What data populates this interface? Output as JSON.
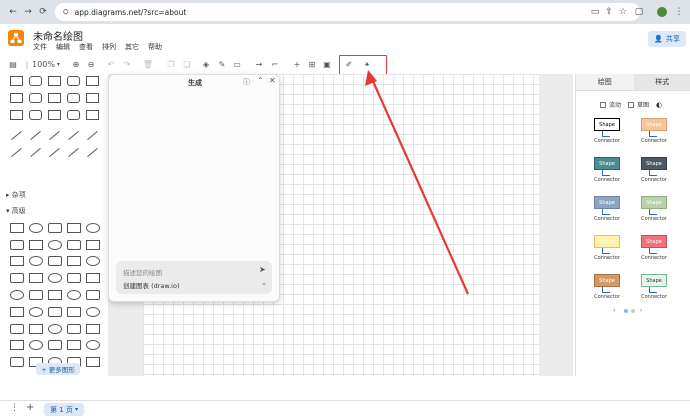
{
  "browser": {
    "url": "app.diagrams.net/?src=about"
  },
  "app": {
    "title": "未命名绘图",
    "menu": [
      "文件",
      "编辑",
      "查看",
      "排列",
      "其它",
      "帮助"
    ],
    "share_label": "共享"
  },
  "toolbar": {
    "zoom": "100%"
  },
  "left_panel": {
    "section_misc": "杂项",
    "section_advanced": "高级",
    "more_shapes": "+ 更多图形"
  },
  "dialog": {
    "title": "生成",
    "help": "?",
    "placeholder": "描述您的绘图",
    "option": "创建图表 (draw.io)"
  },
  "right_panel": {
    "tabs": [
      "绘图",
      "样式"
    ],
    "checkbox_sketch": "草图",
    "checkbox_flow": "流动",
    "styles": [
      {
        "label": "Shape",
        "connector": "Connector",
        "fill": "#ffffff",
        "stroke": "#000000",
        "text": "#000000"
      },
      {
        "label": "Shape",
        "connector": "Connector",
        "fill": "#f5c69a",
        "stroke": "#d8a16f",
        "text": "#ffffff"
      },
      {
        "label": "Shape",
        "connector": "Connector",
        "fill": "#4b8c8f",
        "stroke": "#2f6467",
        "text": "#ffffff"
      },
      {
        "label": "Shape",
        "connector": "Connector",
        "fill": "#4d5a66",
        "stroke": "#36404a",
        "text": "#ffffff"
      },
      {
        "label": "Shape",
        "connector": "Connector",
        "fill": "#8da4c3",
        "stroke": "#6c84a6",
        "text": "#ffffff"
      },
      {
        "label": "Shape",
        "connector": "Connector",
        "fill": "#b7d1ad",
        "stroke": "#8fb083",
        "text": "#ffffff"
      },
      {
        "label": "Shape",
        "connector": "Connector",
        "fill": "#fdf2a6",
        "stroke": "#d9c66b",
        "text": "#ffffff"
      },
      {
        "label": "Shape",
        "connector": "Connector",
        "fill": "#f0737a",
        "stroke": "#c94d55",
        "text": "#ffffff"
      },
      {
        "label": "Shape",
        "connector": "Connector",
        "fill": "#d39a66",
        "stroke": "#a9733f",
        "text": "#ffffff"
      },
      {
        "label": "Shape",
        "connector": "Connector",
        "fill": "#e6f4ee",
        "stroke": "#6fb797",
        "text": "#333333"
      }
    ]
  },
  "bottom": {
    "page_tab": "第 1 页"
  },
  "colors": {
    "highlight": "#e53935",
    "accent": "#1a5ea8",
    "logo": "#f08705"
  }
}
